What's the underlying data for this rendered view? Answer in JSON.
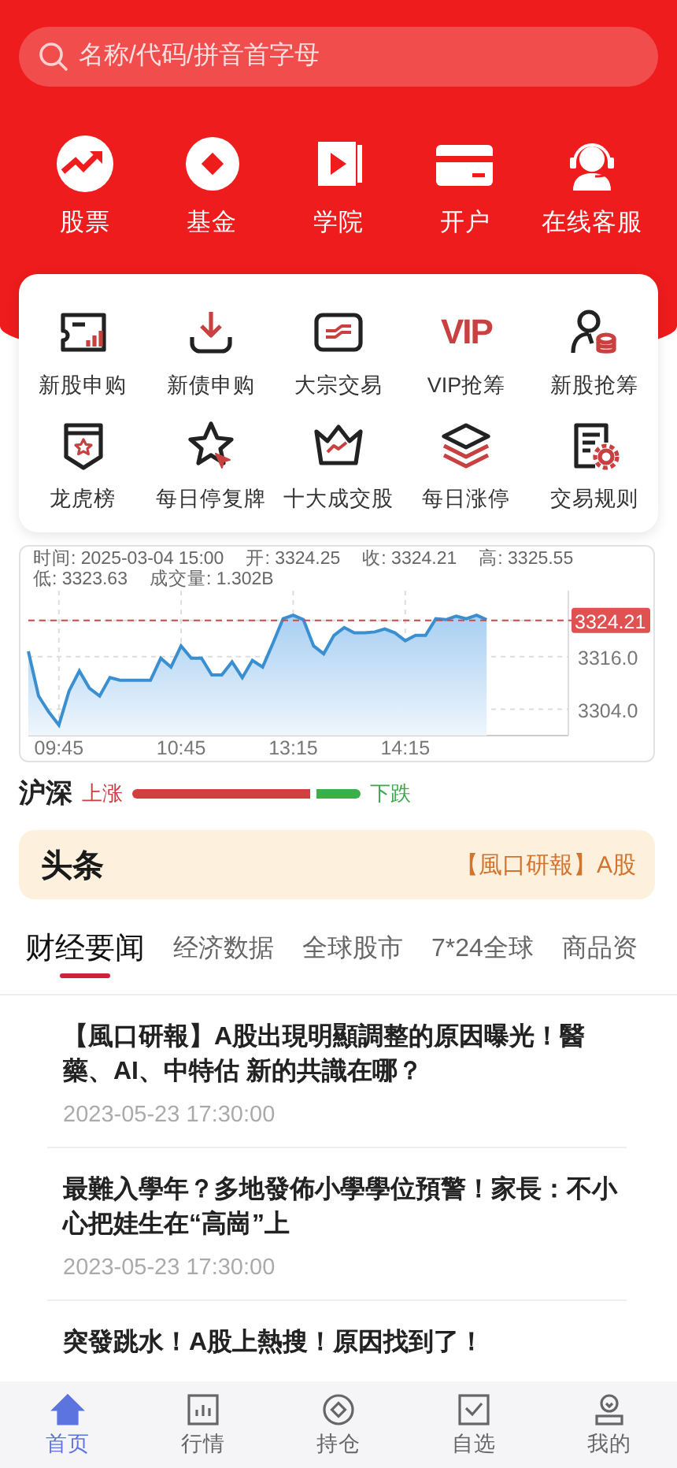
{
  "search": {
    "placeholder": "名称/代码/拼音首字母"
  },
  "quick_links": [
    {
      "label": "股票"
    },
    {
      "label": "基金"
    },
    {
      "label": "学院"
    },
    {
      "label": "开户"
    },
    {
      "label": "在线客服"
    }
  ],
  "services": [
    {
      "label": "新股申购"
    },
    {
      "label": "新债申购"
    },
    {
      "label": "大宗交易"
    },
    {
      "label": "VIP抢筹",
      "badge_text": "VIP"
    },
    {
      "label": "新股抢筹"
    },
    {
      "label": "龙虎榜"
    },
    {
      "label": "每日停复牌"
    },
    {
      "label": "十大成交股"
    },
    {
      "label": "每日涨停"
    },
    {
      "label": "交易规则"
    }
  ],
  "index_chart": {
    "info": [
      "时间: 2025-03-04 15:00",
      "开: 3324.25",
      "收: 3324.21",
      "高: 3325.55",
      "低: 3323.63",
      "成交量: 1.302B"
    ],
    "chart_data": {
      "type": "area",
      "categories": [
        null,
        null,
        null,
        "09:45",
        null,
        null,
        null,
        null,
        null,
        null,
        null,
        null,
        null,
        null,
        null,
        "10:45",
        null,
        null,
        null,
        null,
        null,
        null,
        null,
        null,
        null,
        null,
        "13:15",
        null,
        null,
        null,
        null,
        null,
        null,
        null,
        null,
        null,
        null,
        "14:15",
        null,
        null,
        null,
        null,
        null,
        null,
        null,
        null
      ],
      "series": [
        {
          "color": "#3a8fd0",
          "values": [
            3317.2,
            3307.0,
            3303.4,
            3300.4,
            3308.2,
            3312.7,
            3308.8,
            3307.0,
            3311.2,
            3310.6,
            3310.6,
            3310.6,
            3310.6,
            3315.6,
            3313.6,
            3318.4,
            3315.6,
            3315.6,
            3311.8,
            3311.8,
            3314.8,
            3311.2,
            3315.1,
            3313.6,
            3319.0,
            3324.6,
            3325.4,
            3324.4,
            3318.4,
            3316.6,
            3320.8,
            3322.6,
            3321.4,
            3321.4,
            3321.6,
            3322.3,
            3321.4,
            3319.6,
            3320.8,
            3320.8,
            3324.6,
            3324.4,
            3325.2,
            3324.6,
            3325.4,
            3324.4
          ]
        }
      ],
      "ylim": [
        3298,
        3331
      ],
      "grid": true,
      "ref_lines": [
        {
          "axis": "y",
          "value": 3324.21,
          "color": "#d04848"
        }
      ],
      "yticks": [
        {
          "value": 3324.21,
          "label": "3324.21"
        },
        {
          "value": 3316,
          "label": "3316.0"
        },
        {
          "value": 3304,
          "label": "3304.0"
        }
      ]
    }
  },
  "breadth": {
    "market": "沪深",
    "up_label": "上涨",
    "down_label": "下跌",
    "level": 0.78
  },
  "headline": {
    "logo": "头条",
    "text": "【風口研報】A股"
  },
  "news_tabs": [
    {
      "label": "财经要闻",
      "selected": true
    },
    {
      "label": "经济数据",
      "selected": false
    },
    {
      "label": "全球股市",
      "selected": false
    },
    {
      "label": "7*24全球",
      "selected": false
    },
    {
      "label": "商品资",
      "selected": false
    }
  ],
  "news": [
    {
      "title": "【風口研報】A股出現明顯調整的原因曝光！醫藥、AI、中特估 新的共識在哪？",
      "time": "2023-05-23 17:30:00"
    },
    {
      "title": "最難入學年？多地發佈小學學位預警！家長：不小心把娃生在“高崗”上",
      "time": "2023-05-23 17:30:00"
    },
    {
      "title": "突發跳水！A股上熱搜！原因找到了！"
    }
  ],
  "tab_bar": [
    {
      "label": "首页",
      "selected": true
    },
    {
      "label": "行情",
      "selected": false
    },
    {
      "label": "持仓",
      "selected": false
    },
    {
      "label": "自选",
      "selected": false
    },
    {
      "label": "我的",
      "selected": false
    }
  ]
}
